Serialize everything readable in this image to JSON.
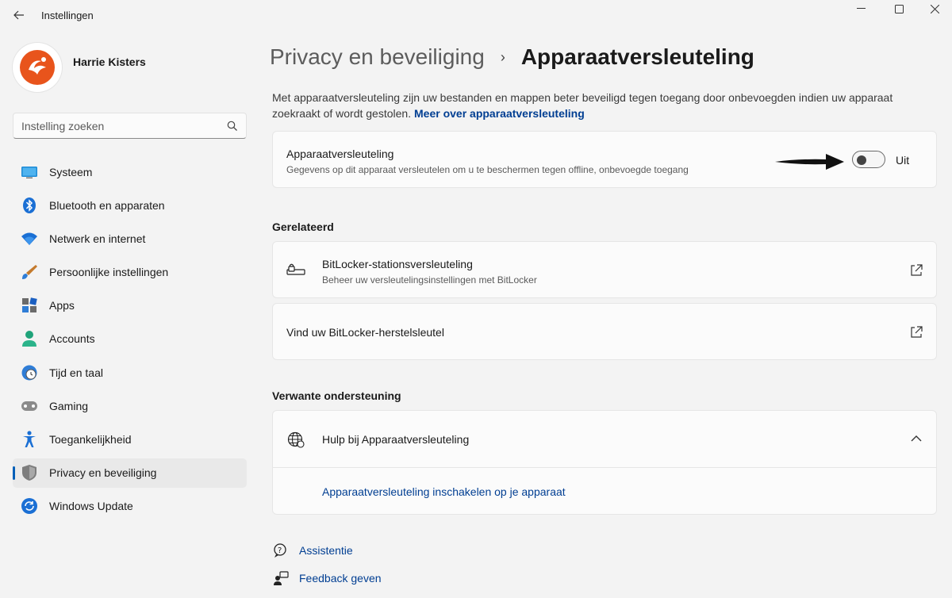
{
  "window": {
    "title": "Instellingen"
  },
  "user": {
    "name": "Harrie Kisters"
  },
  "search": {
    "placeholder": "Instelling zoeken"
  },
  "nav": {
    "items": [
      {
        "label": "Systeem",
        "icon": "monitor-icon"
      },
      {
        "label": "Bluetooth en apparaten",
        "icon": "bluetooth-icon"
      },
      {
        "label": "Netwerk en internet",
        "icon": "wifi-icon"
      },
      {
        "label": "Persoonlijke instellingen",
        "icon": "brush-icon"
      },
      {
        "label": "Apps",
        "icon": "apps-icon"
      },
      {
        "label": "Accounts",
        "icon": "person-icon"
      },
      {
        "label": "Tijd en taal",
        "icon": "clock-globe-icon"
      },
      {
        "label": "Gaming",
        "icon": "gamepad-icon"
      },
      {
        "label": "Toegankelijkheid",
        "icon": "accessibility-icon"
      },
      {
        "label": "Privacy en beveiliging",
        "icon": "shield-icon",
        "active": true
      },
      {
        "label": "Windows Update",
        "icon": "update-icon"
      }
    ]
  },
  "breadcrumb": {
    "parent": "Privacy en beveiliging",
    "separator": "›",
    "current": "Apparaatversleuteling"
  },
  "description": {
    "text": "Met apparaatversleuteling zijn uw bestanden en mappen beter beveiligd tegen toegang door onbevoegden indien uw apparaat zoekraakt of wordt gestolen. ",
    "link": "Meer over apparaatversleuteling"
  },
  "encryption_card": {
    "title": "Apparaatversleuteling",
    "subtitle": "Gegevens op dit apparaat versleutelen om u te beschermen tegen offline, onbevoegde toegang",
    "toggle_state": "Uit",
    "toggle_on": false
  },
  "related": {
    "heading": "Gerelateerd",
    "items": [
      {
        "title": "BitLocker-stationsversleuteling",
        "subtitle": "Beheer uw versleutelingsinstellingen met BitLocker",
        "icon": "bitlocker-icon"
      },
      {
        "title": "Vind uw BitLocker-herstelsleutel"
      }
    ]
  },
  "support": {
    "heading": "Verwante ondersteuning",
    "title": "Hulp bij Apparaatversleuteling",
    "link": "Apparaatversleuteling inschakelen op je apparaat"
  },
  "footer": {
    "assist": "Assistentie",
    "feedback": "Feedback geven"
  },
  "colors": {
    "accent": "#005fb8",
    "link": "#003e92",
    "background": "#f3f3f3",
    "card": "#fbfbfb"
  }
}
